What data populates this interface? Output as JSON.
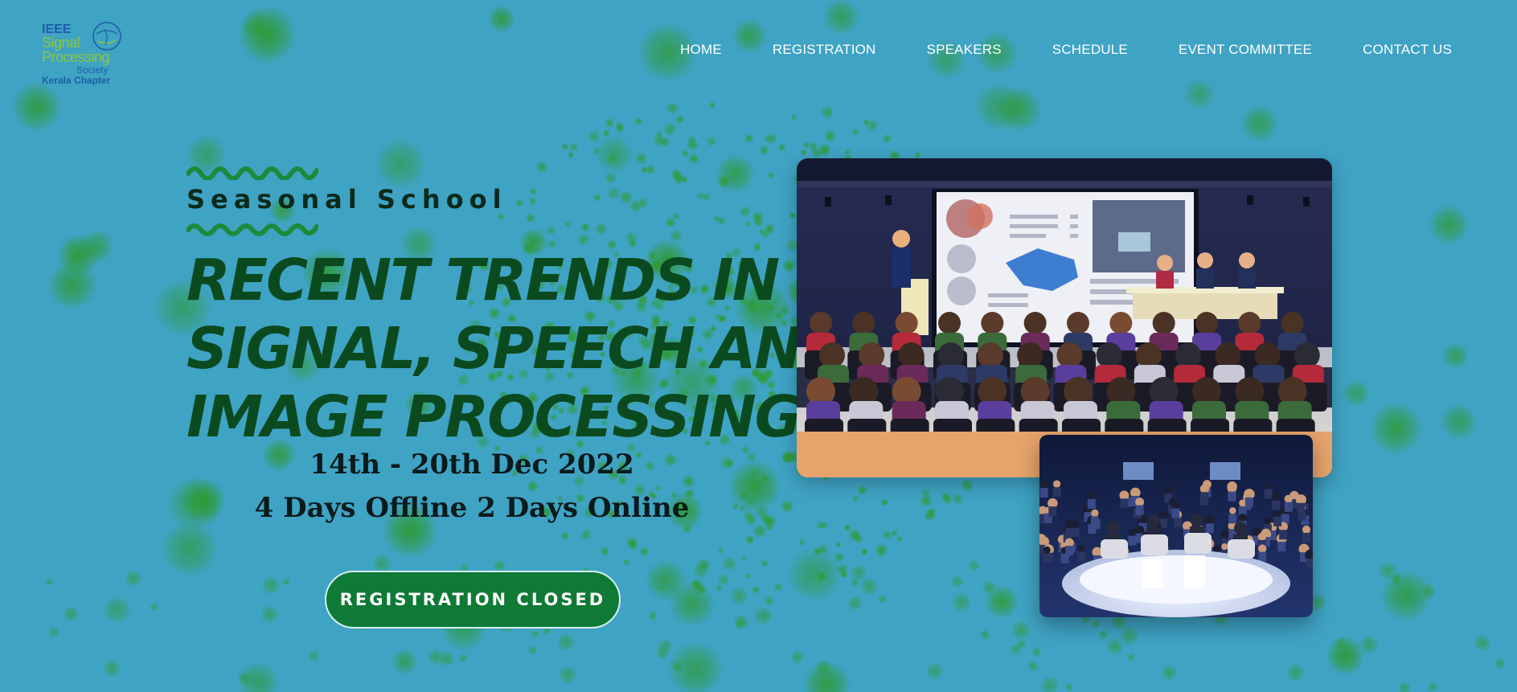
{
  "logo": {
    "line1": "IEEE",
    "line2": "Signal",
    "line3": "Processing",
    "line4": "Society",
    "line5": "Kerala Chapter"
  },
  "nav": {
    "items": [
      "HOME",
      "REGISTRATION",
      "SPEAKERS",
      "SCHEDULE",
      "EVENT COMMITTEE",
      "CONTACT US"
    ]
  },
  "hero": {
    "subtitle": "Seasonal School",
    "title_lines": [
      "RECENT TRENDS IN",
      "SIGNAL, SPEECH AND",
      "IMAGE PROCESSING"
    ],
    "dates": "14th - 20th Dec 2022",
    "mode": "4 Days Offline 2 Days Online",
    "button_label": "REGISTRATION CLOSED"
  },
  "colors": {
    "background": "#3fa3c4",
    "title": "#0b4a1f",
    "button": "#0e7a36",
    "wave": "#1c8a3a",
    "nav_text": "#ffffff"
  }
}
